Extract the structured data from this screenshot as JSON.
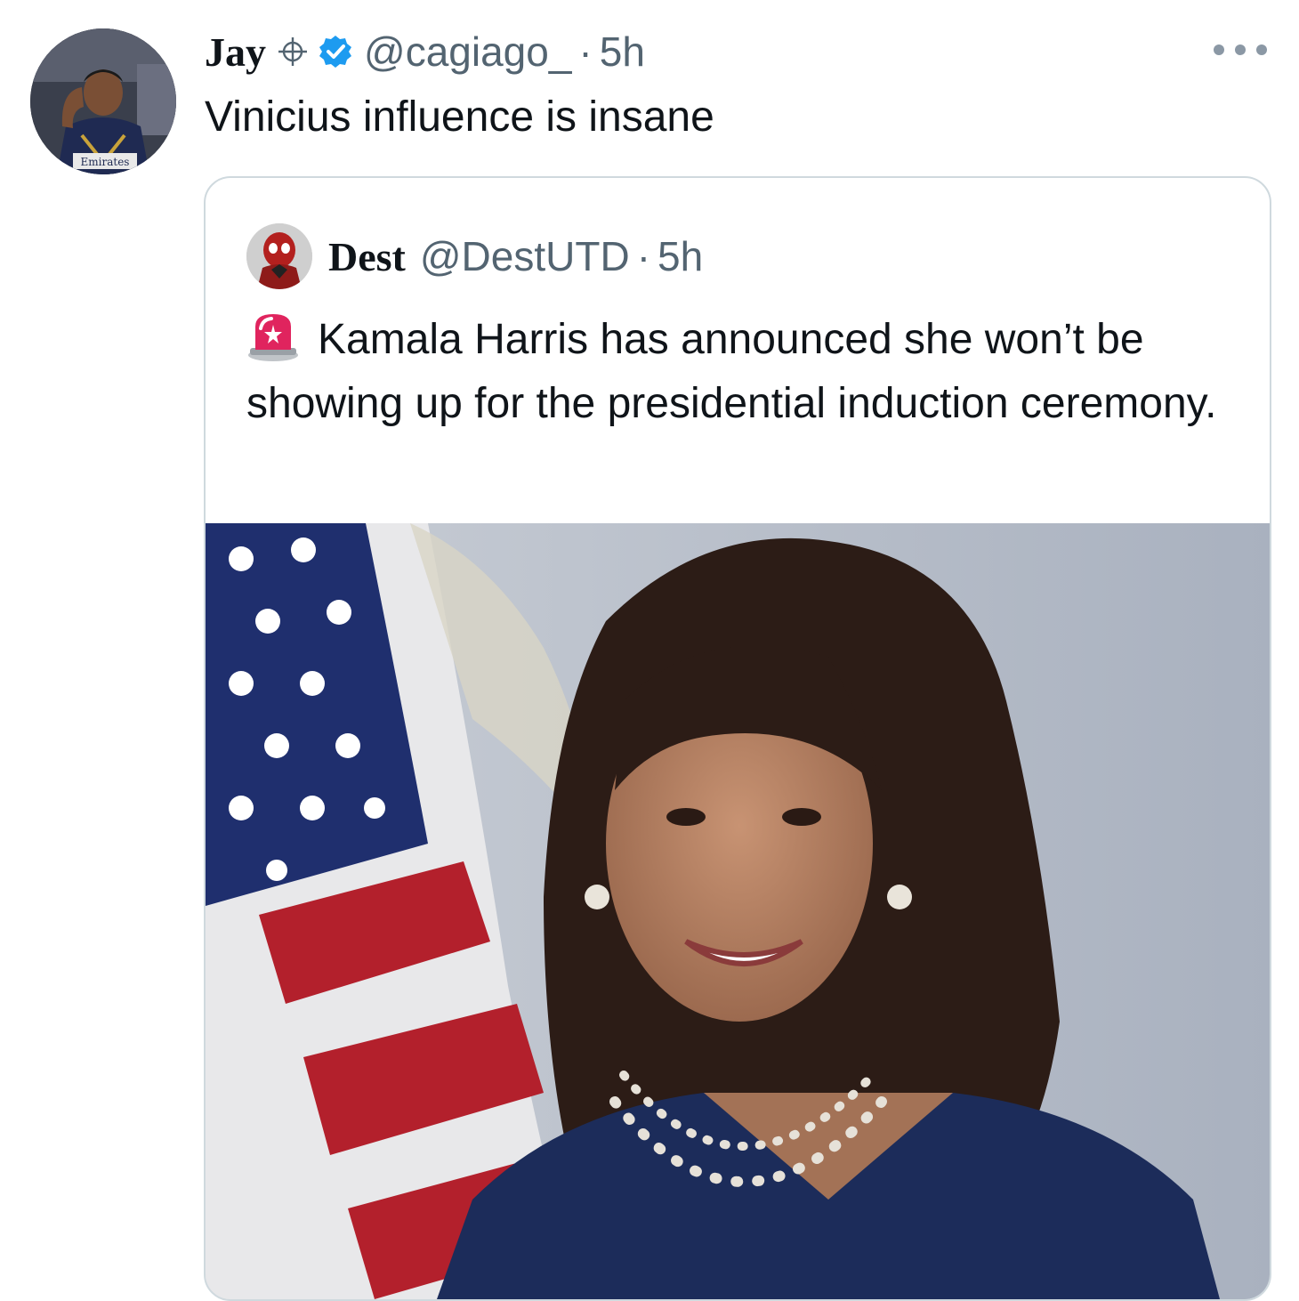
{
  "tweet": {
    "author_name": "Jay",
    "handle": "@cagiago_",
    "separator": "·",
    "time": "5h",
    "text": "Vinicius influence is insane",
    "avatar_caption": "Emirates"
  },
  "quoted_tweet": {
    "author_name": "Dest",
    "handle": "@DestUTD",
    "separator": "·",
    "time": "5h",
    "text": "Kamala Harris has announced she won’t be showing up for the presidential induction ceremony."
  },
  "icons": {
    "more": "more-options-icon",
    "verified": "verified-badge-icon",
    "crosshair": "crosshair-icon",
    "siren": "rotating-light-icon"
  },
  "colors": {
    "text_primary": "#0f1419",
    "text_secondary": "#536471",
    "verified_blue": "#1d9bf0",
    "card_border": "#cfd9de"
  }
}
